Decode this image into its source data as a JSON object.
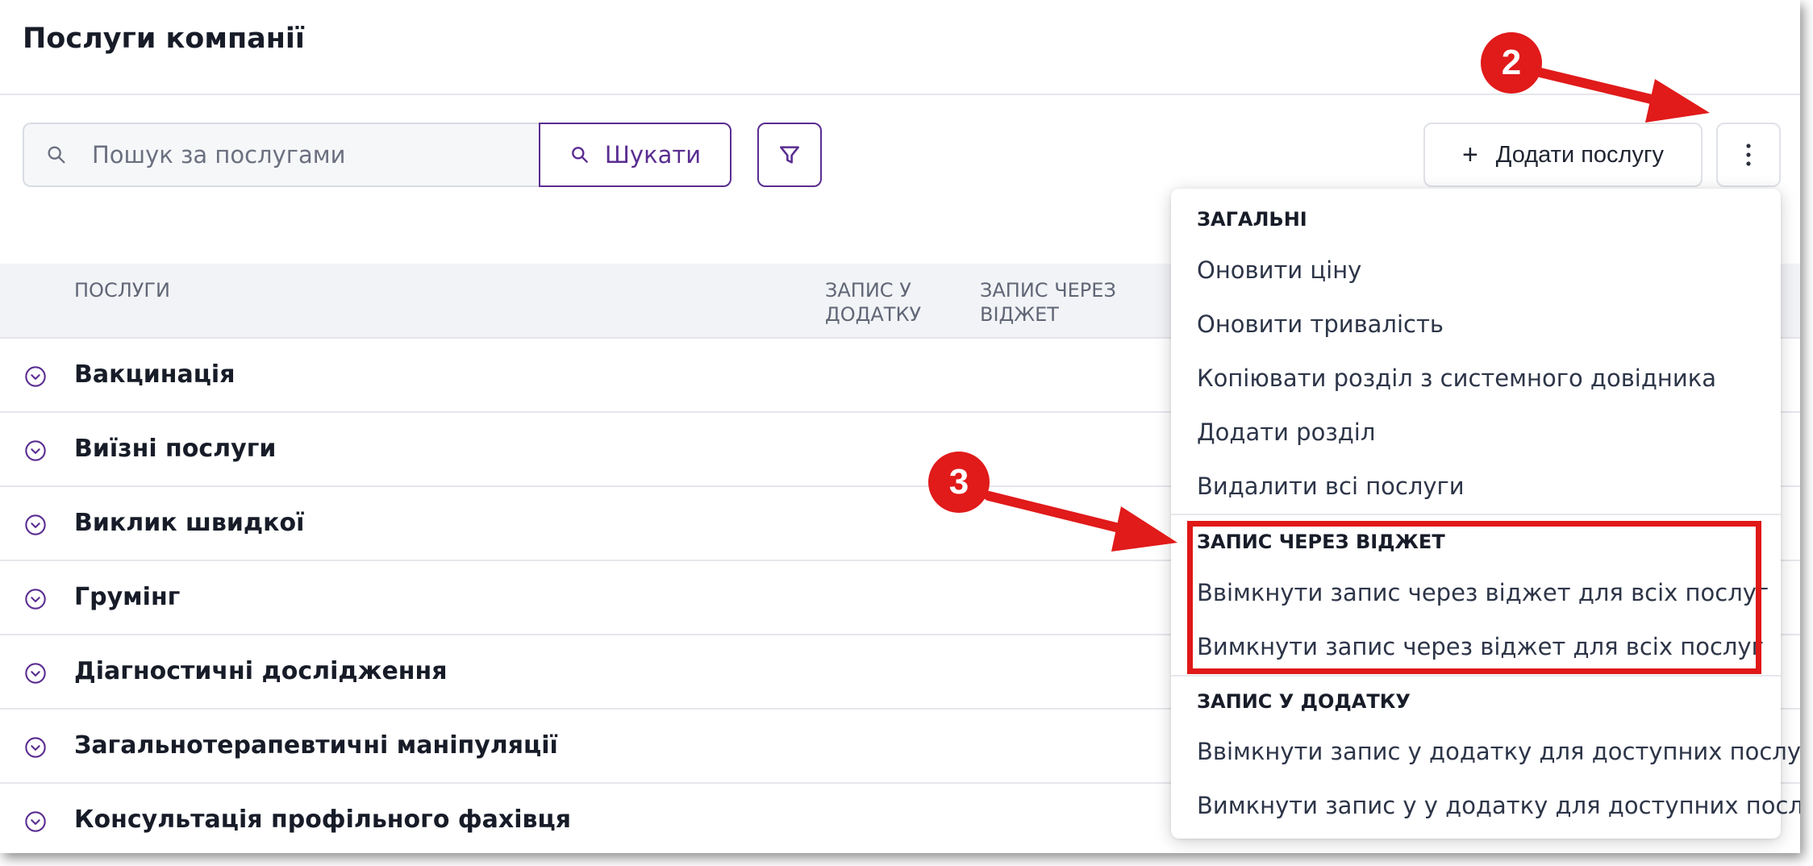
{
  "page": {
    "title": "Послуги компанії"
  },
  "toolbar": {
    "search_placeholder": "Пошук за послугами",
    "search_button": "Шукати",
    "add_button": "Додати послугу",
    "accent_color": "#5a2d91"
  },
  "table": {
    "headers": {
      "services": "ПОСЛУГИ",
      "app": "ЗАПИС У ДОДАТКУ",
      "widget": "ЗАПИС ЧЕРЕЗ ВІДЖЕТ"
    },
    "rows": [
      "Вакцинація",
      "Виїзні послуги",
      "Виклик швидкої",
      "Грумінг",
      "Діагностичні дослідження",
      "Загальнотерапевтичні маніпуляції",
      "Консультація профільного фахівця"
    ]
  },
  "menu": {
    "general": {
      "title": "ЗАГАЛЬНІ",
      "items": [
        "Оновити ціну",
        "Оновити тривалість",
        "Копіювати розділ з системного довідника",
        "Додати розділ",
        "Видалити всі послуги"
      ]
    },
    "widget": {
      "title": "ЗАПИС ЧЕРЕЗ ВІДЖЕТ",
      "items": [
        "Ввімкнути запис через віджет для всіх послуг",
        "Вимкнути запис через віджет для всіх послуг"
      ]
    },
    "app": {
      "title": "ЗАПИС У ДОДАТКУ",
      "items": [
        "Ввімкнути запис у додатку для доступних послуг",
        "Вимкнути запис у у додатку для доступних послуг"
      ]
    }
  },
  "annotations": {
    "badge_2": "2",
    "badge_3": "3",
    "color": "#e11a1a"
  }
}
